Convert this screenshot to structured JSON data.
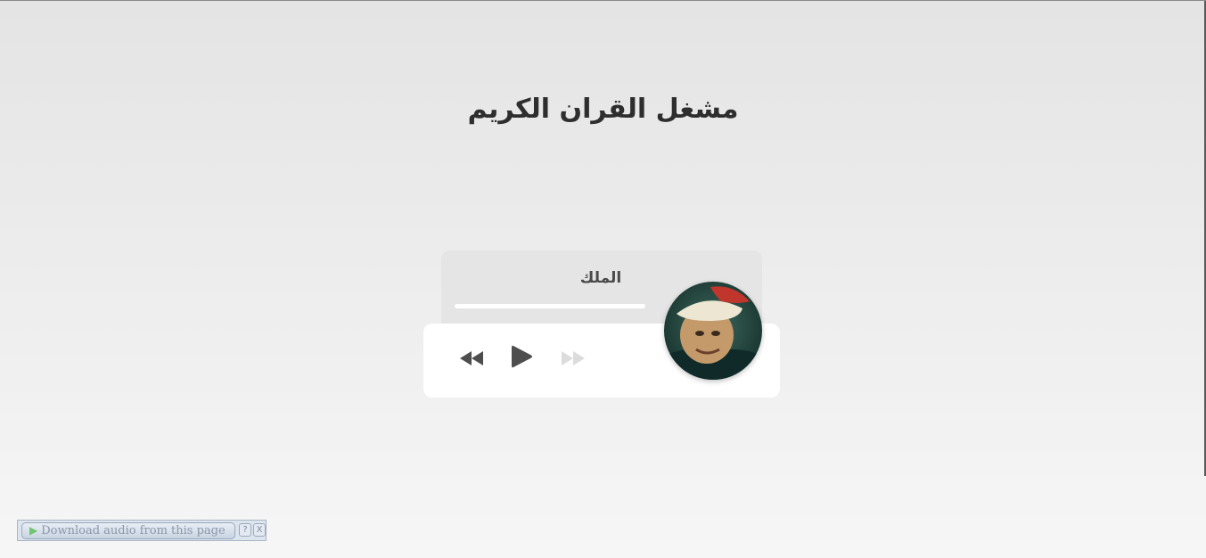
{
  "page": {
    "title": "مشغل القران الكريم"
  },
  "player": {
    "track_title": "الملك",
    "progress_fraction": 0,
    "controls": {
      "prev_icon": "backward-icon",
      "play_icon": "play-icon",
      "next_icon": "forward-icon"
    },
    "cover_image": "reciter-portrait"
  },
  "extension_bar": {
    "download_label": "Download audio from this page",
    "help_label": "?",
    "close_label": "X"
  }
}
